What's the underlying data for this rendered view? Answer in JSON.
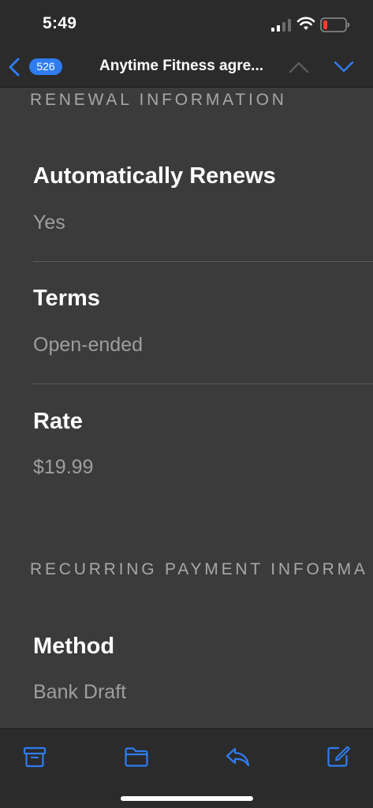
{
  "status_bar": {
    "time": "5:49"
  },
  "nav": {
    "unread_count": "526",
    "title": "Anytime Fitness agre...",
    "back_icon": "chevron-left-icon",
    "prev_icon": "chevron-up-icon",
    "next_icon": "chevron-down-icon"
  },
  "email_body": {
    "renewal_heading": "RENEWAL INFORMATION",
    "renewal_fields": [
      {
        "label": "Automatically Renews",
        "value": "Yes"
      },
      {
        "label": "Terms",
        "value": "Open-ended"
      },
      {
        "label": "Rate",
        "value": "$19.99"
      }
    ],
    "recurring_heading": "RECURRING PAYMENT INFORMA",
    "recurring_fields": [
      {
        "label": "Method",
        "value": "Bank Draft"
      }
    ]
  },
  "toolbar": {
    "icons": [
      "archive-icon",
      "folder-icon",
      "reply-icon",
      "compose-icon"
    ]
  },
  "colors": {
    "accent": "#2f7cf0",
    "background": "#3b3b3c",
    "bar_background": "#2b2b2c",
    "secondary_text": "#9e9e9f"
  }
}
